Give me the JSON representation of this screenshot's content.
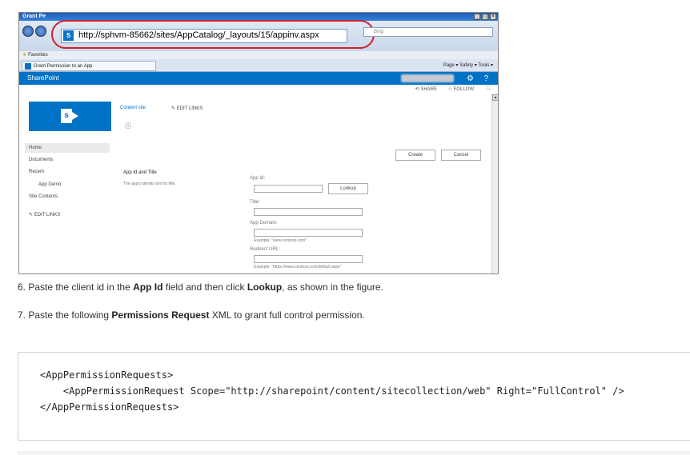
{
  "browser": {
    "window_title": "Grant Pe",
    "url": "http://sphvm-85662/sites/AppCatalog/_layouts/15/appinv.aspx",
    "search_placeholder": "Bing",
    "favorites_label": "Favorites",
    "tab_title": "Grant Permission to an App",
    "command_bar": "Page ▾   Safety ▾   Tools ▾",
    "highlight_color": "#d0202a"
  },
  "sharepoint": {
    "suite_title": "SharePoint",
    "share_label": "SHARE",
    "follow_label": "FOLLOW",
    "brand_color": "#0072c6",
    "breadcrumb_link": "Content site",
    "edit_links_top": "EDIT LINKS",
    "info_glyph": "ⓘ",
    "nav": {
      "items": [
        "Home",
        "Documents",
        "Recent",
        "App Demo",
        "Site Contents"
      ],
      "edit_links": "EDIT LINKS"
    },
    "create_button": "Create",
    "cancel_button": "Cancel",
    "section_title": "App Id and Title",
    "section_desc": "The app's identity and its title.",
    "fields": {
      "app_id_label": "App Id:",
      "lookup_button": "Lookup",
      "title_label": "Title:",
      "app_domain_label": "App Domain:",
      "app_domain_example": "Example: \"www.contoso.com\"",
      "redirect_label": "Redirect URL:",
      "redirect_example": "Example: \"https://www.contoso.com/default.aspx\""
    }
  },
  "steps": {
    "step6": {
      "pre": "6. Paste the client id in the ",
      "b1": "App Id",
      "mid": " field and then click ",
      "b2": "Lookup",
      "post": ", as shown in the figure."
    },
    "step7": {
      "pre": "7. Paste the following ",
      "b1": "Permissions Request",
      "post": " XML to grant full control permission."
    }
  },
  "code": {
    "line1": "<AppPermissionRequests>",
    "line2": "    <AppPermissionRequest Scope=\"http://sharepoint/content/sitecollection/web\" Right=\"FullControl\" />",
    "line3": "</AppPermissionRequests>"
  }
}
